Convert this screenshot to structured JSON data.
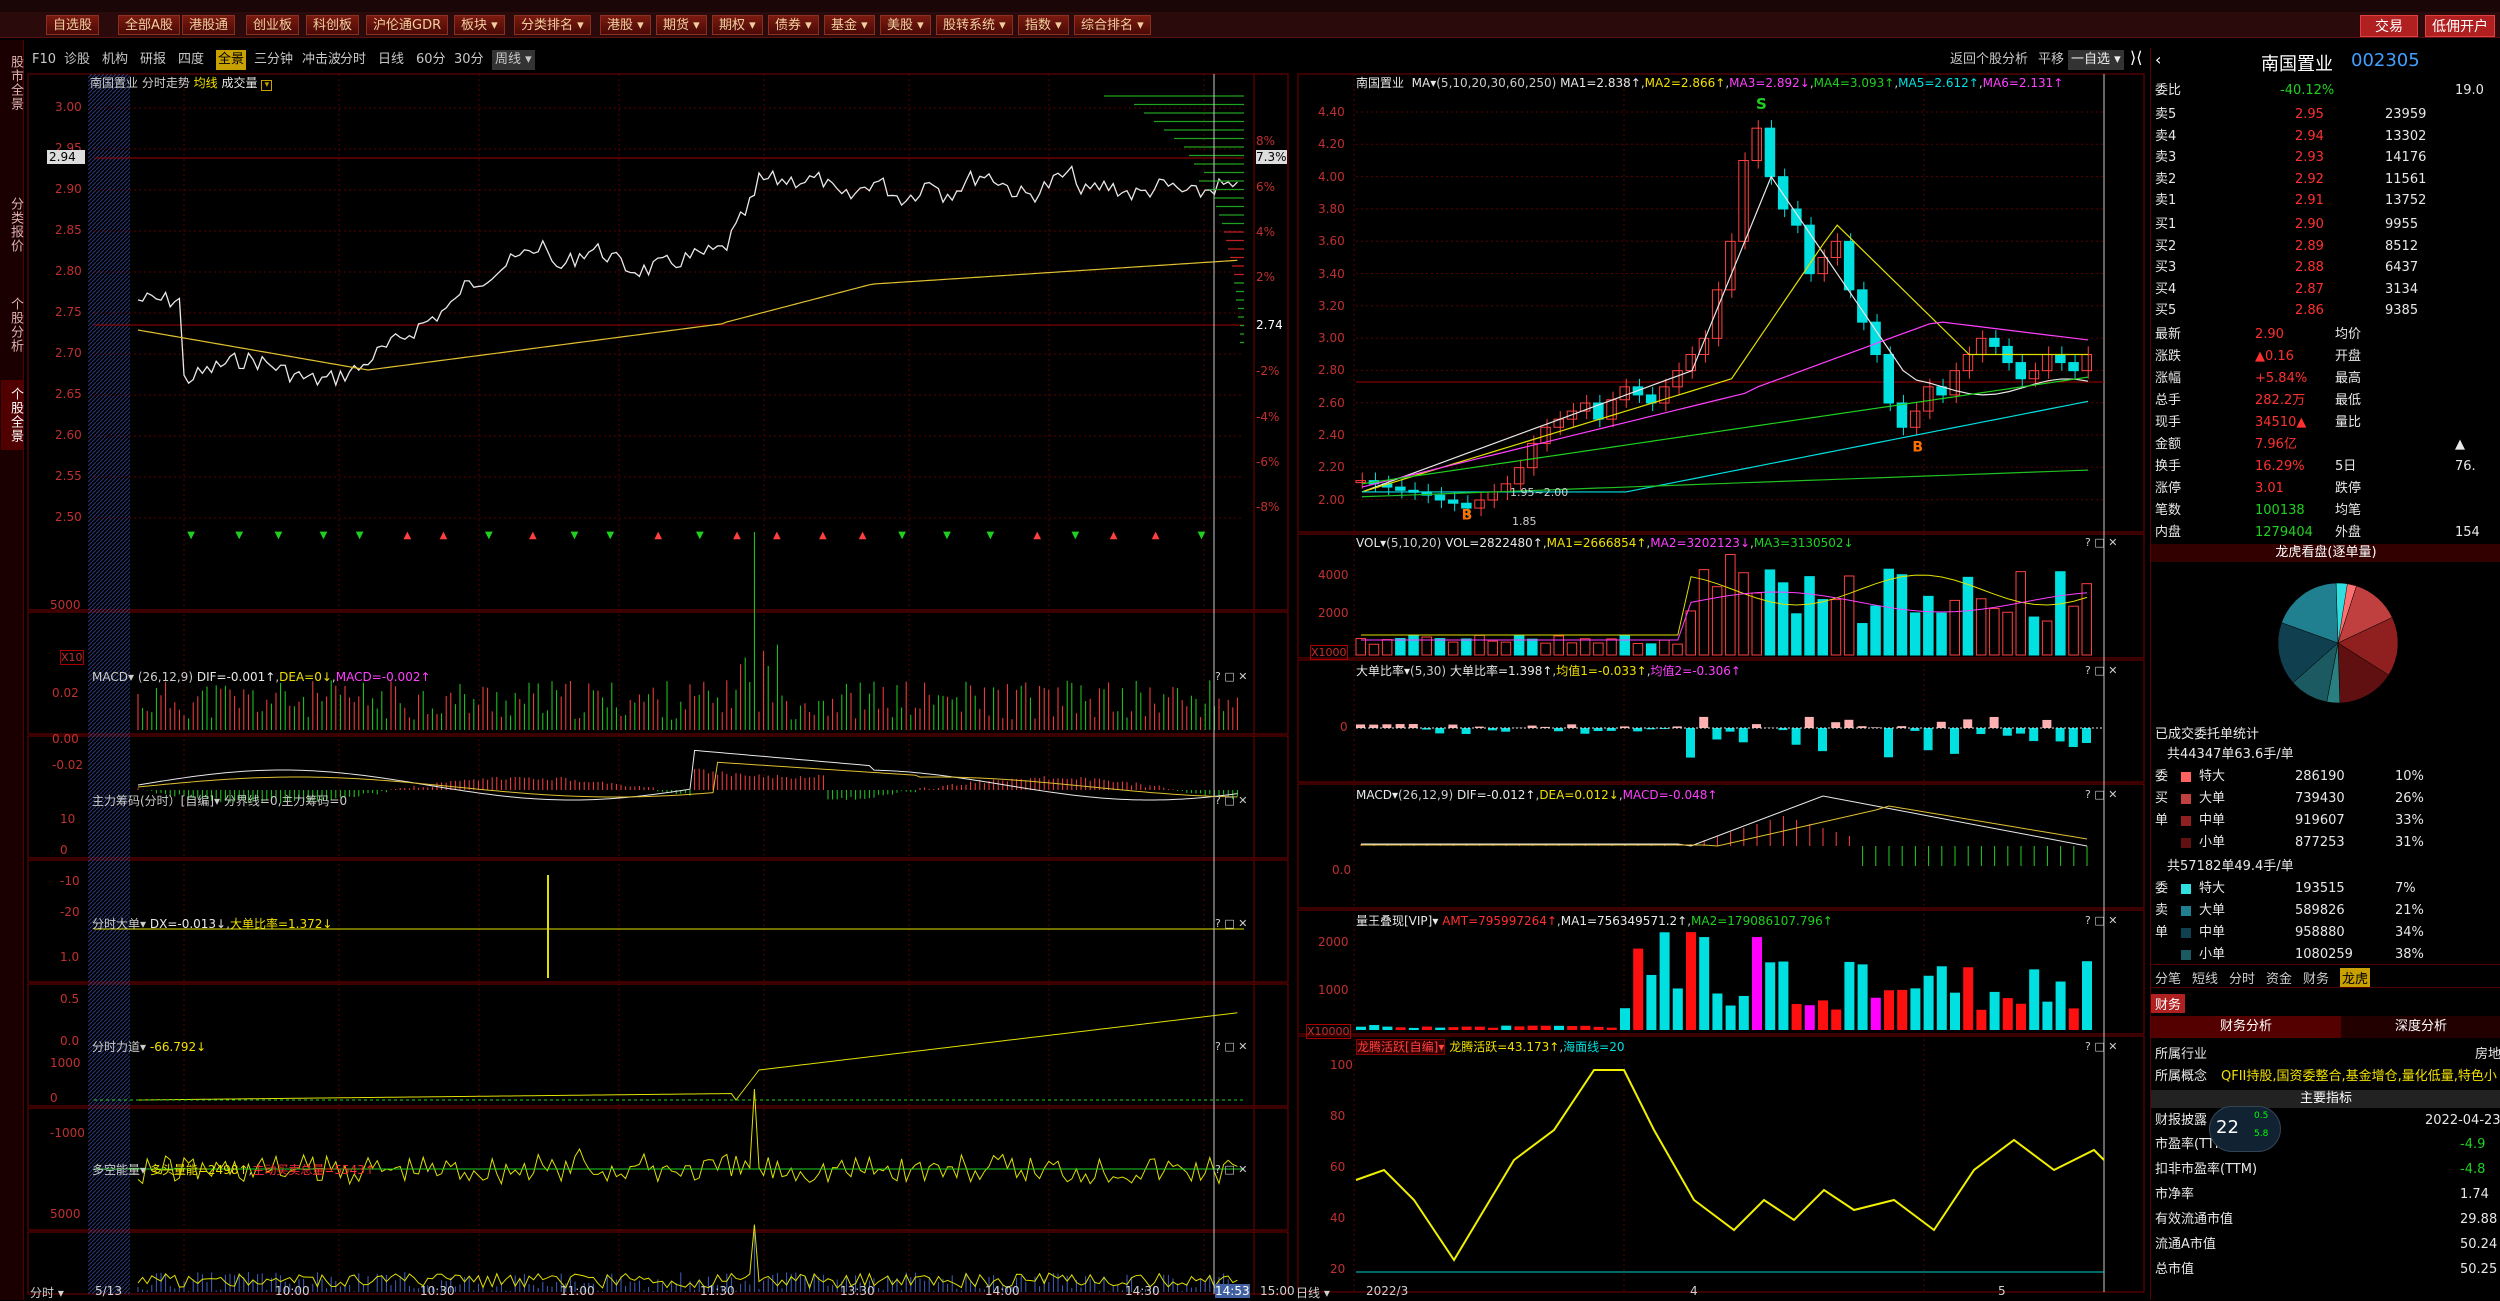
{
  "toolbar": {
    "buttons": [
      "自选股",
      "全部A股",
      "港股通",
      "创业板",
      "科创板",
      "沪伦通GDR",
      "板块 ▾",
      "分类排名 ▾",
      "港股 ▾",
      "期货 ▾",
      "期权 ▾",
      "债券 ▾",
      "基金 ▾",
      "美股 ▾",
      "股转系统 ▾",
      "指数 ▾",
      "综合排名 ▾"
    ],
    "trade": "交易",
    "open_account": "低佣开户"
  },
  "sidebar": [
    "股市全景",
    "分类报价",
    "个股分析",
    "个股全景"
  ],
  "left_tabs": [
    "F10",
    "诊股",
    "机构",
    "研报",
    "四度",
    "全景",
    "三分钟",
    "冲击波"
  ],
  "left_tab_active": "全景",
  "mid_tabs": [
    "分时",
    "日线",
    "60分",
    "30分",
    "周线 ▾"
  ],
  "right_top": [
    "返回个股分析",
    "平移",
    "一自选 ▾"
  ],
  "intraday": {
    "title": "南国置业  分时走势",
    "avg_label": "均线",
    "vol_label": "成交量",
    "price_ticks": [
      "3.00",
      "2.95",
      "2.90",
      "2.85",
      "2.80",
      "2.75",
      "2.70",
      "2.65",
      "2.60",
      "2.55",
      "2.50"
    ],
    "cur_price": "2.94",
    "pct_ticks": [
      "8%",
      "7.3%",
      "6%",
      "4%",
      "2%",
      "2.74",
      "-2%",
      "-4%",
      "-6%",
      "-8%"
    ],
    "time_ticks": [
      "5/13",
      "10:00",
      "10:30",
      "11:00",
      "11:30",
      "13:30",
      "14:00",
      "14:30",
      "14:53",
      "15:00"
    ],
    "bottom_left": "分时 ▾",
    "vol_tick": "5000",
    "vol_unit": "X10"
  },
  "macd1": {
    "name": "MACD",
    "params": "(26,12,9)",
    "dif": "DIF=-0.001↑",
    "dea": "DEA=0↓",
    "macd": "MACD=-0.002↑",
    "ticks": [
      "0.02",
      "0.00",
      "-0.02"
    ]
  },
  "zlcm": {
    "text": "主力筹码(分时）[自编]▾ 分界线=0,主力筹码=0",
    "ticks": [
      "10",
      "0",
      "-10",
      "-20"
    ]
  },
  "fsdd": {
    "name": "分时大单▾",
    "dx": "DX=-0.013↓",
    "bl": "大单比率=1.372↓",
    "ticks": [
      "1.0",
      "0.5",
      "0.0"
    ]
  },
  "fsld": {
    "name": "分时力道▾",
    "val": "-66.792↓",
    "ticks": [
      "1000",
      "0",
      "-1000"
    ]
  },
  "dkn": {
    "name": "多空能量▾",
    "a": "多头量能=2498↑",
    "b": "主动买卖总量=5543↑",
    "tick": "5000"
  },
  "kline": {
    "title": "南国置业",
    "ma_label": "MA▾",
    "ma_params": "(5,10,20,30,60,250)",
    "ma1": "MA1=2.838↑",
    "ma2": "MA2=2.866↑",
    "ma3": "MA3=2.892↓",
    "ma4": "MA4=3.093↑",
    "ma5": "MA5=2.612↑",
    "ma6": "MA6=2.131↑",
    "price_ticks": [
      "4.40",
      "4.20",
      "4.00",
      "3.80",
      "3.60",
      "3.40",
      "3.20",
      "3.00",
      "2.80",
      "2.60",
      "2.40",
      "2.20",
      "2.00"
    ],
    "low_mark": "1.95~2.00",
    "low_label": "1.85",
    "bottom_left": "日线 ▾",
    "dates": [
      "2022/3",
      "4",
      "5"
    ]
  },
  "vol2": {
    "name": "VOL▾",
    "params": "(5,10,20)",
    "v": "VOL=2822480↑",
    "m1": "MA1=2666854↑",
    "m2": "MA2=3202123↓",
    "m3": "MA3=3130502↓",
    "ticks": [
      "4000",
      "2000"
    ],
    "unit": "X1000"
  },
  "ddbl": {
    "name": "大单比率▾",
    "params": "(5,30)",
    "v": "大单比率=1.398↑",
    "j1": "均值1=-0.033↑",
    "j2": "均值2=-0.306↑",
    "tick": "0"
  },
  "macd2": {
    "name": "MACD▾",
    "params": "(26,12,9)",
    "dif": "DIF=-0.012↑",
    "dea": "DEA=0.012↓",
    "macd": "MACD=-0.048↑",
    "tick": "0.0"
  },
  "lwdx": {
    "name": "量王叠现[VIP]▾",
    "amt": "AMT=795997264↑",
    "m1": "MA1=756349571.2↑",
    "m2": "MA2=179086107.796↑",
    "ticks": [
      "2000",
      "1000"
    ],
    "unit": "X10000"
  },
  "lths": {
    "name": "龙腾活跃[自编]▾",
    "v": "龙腾活跃=43.173↑",
    "h": "海面线=20",
    "ticks": [
      "100",
      "80",
      "60",
      "40",
      "20"
    ]
  },
  "quote": {
    "name": "南国置业",
    "code": "002305",
    "weibi_label": "委比",
    "weibi": "-40.12%",
    "weicha": "19.0",
    "sell": [
      [
        "卖5",
        "2.95",
        "23959"
      ],
      [
        "卖4",
        "2.94",
        "13302"
      ],
      [
        "卖3",
        "2.93",
        "14176"
      ],
      [
        "卖2",
        "2.92",
        "11561"
      ],
      [
        "卖1",
        "2.91",
        "13752"
      ]
    ],
    "buy": [
      [
        "买1",
        "2.90",
        "9955"
      ],
      [
        "买2",
        "2.89",
        "8512"
      ],
      [
        "买3",
        "2.88",
        "6437"
      ],
      [
        "买4",
        "2.87",
        "3134"
      ],
      [
        "买5",
        "2.86",
        "9385"
      ]
    ],
    "stats": [
      [
        "最新",
        "2.90",
        "均价",
        ""
      ],
      [
        "涨跌",
        "▲0.16",
        "开盘",
        ""
      ],
      [
        "涨幅",
        "+5.84%",
        "最高",
        ""
      ],
      [
        "总手",
        "282.2万",
        "最低",
        ""
      ],
      [
        "现手",
        "34510▲",
        "量比",
        ""
      ],
      [
        "金额",
        "7.96亿",
        "",
        " ▲"
      ],
      [
        "换手",
        "16.29%",
        "5日",
        "76."
      ],
      [
        "涨停",
        "3.01",
        "跌停",
        ""
      ],
      [
        "笔数",
        "100138",
        "均笔",
        ""
      ],
      [
        "内盘",
        "1279404",
        "外盘",
        "154"
      ]
    ],
    "lh_title": "龙虎看盘(逐单量)",
    "ycj": "已成交委托单统计",
    "sell_total": "共44347单63.6手/单",
    "sell_rows": [
      [
        "委",
        "特大",
        "286190",
        "10%"
      ],
      [
        "买",
        "大单",
        "739430",
        "26%"
      ],
      [
        "单",
        "中单",
        "919607",
        "33%"
      ],
      [
        "",
        "小单",
        "877253",
        "31%"
      ]
    ],
    "buy_total": "共57182单49.4手/单",
    "buy_rows": [
      [
        "委",
        "特大",
        "193515",
        "7%"
      ],
      [
        "卖",
        "大单",
        "589826",
        "21%"
      ],
      [
        "单",
        "中单",
        "958880",
        "34%"
      ],
      [
        "",
        "小单",
        "1080259",
        "38%"
      ]
    ],
    "bottom_tabs": [
      "分笔",
      "短线",
      "分时",
      "资金",
      "财务",
      "龙虎"
    ],
    "bottom_tab_active": "龙虎",
    "fin_tab": "财务",
    "fin_sub": [
      "财务分析",
      "深度分析"
    ],
    "industry_label": "所属行业",
    "industry": "房地",
    "concept_label": "所属概念",
    "concept": "QFII持股,国资委整合,基金增仓,量化低量,特色小",
    "main_idx": "主要指标",
    "rep_label": "财报披露",
    "rep": "2022-04-23",
    "fin_rows": [
      [
        "市盈率(TTM)",
        "-4.9"
      ],
      [
        "扣非市盈率(TTM)",
        "-4.8"
      ],
      [
        "市净率",
        "1.74"
      ],
      [
        "有效流通市值",
        "29.88"
      ],
      [
        "流通A市值",
        "50.24"
      ],
      [
        "总市值",
        "50.25"
      ]
    ],
    "gauge": "22",
    "gauge_up": "0.5",
    "gauge_dn": "5.8",
    "gauge_unit": "K/s"
  }
}
